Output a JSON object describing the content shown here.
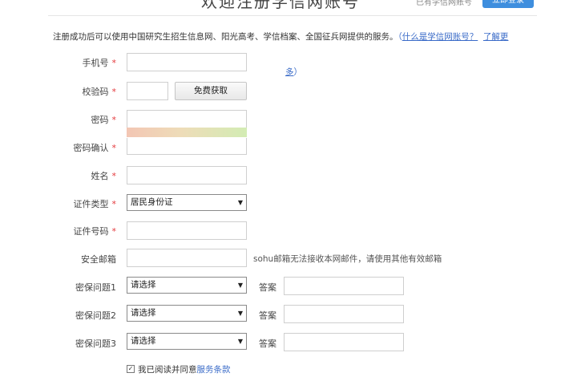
{
  "header": {
    "title": "欢迎注册学信网账号",
    "login_hint": "已有学信网账号",
    "login_button": "立即登录"
  },
  "notice": {
    "text": "注册成功后可以使用中国研究生招生信息网、阳光高考、学信档案、全国征兵网提供的服务。",
    "paren_open": "（",
    "link1": "什么是学信网账号？",
    "link2_part1": "了解更",
    "link2_part2": "多",
    "paren_close": "）"
  },
  "form": {
    "phone_label": "手机号",
    "code_label": "校验码",
    "code_button": "免费获取",
    "password_label": "密码",
    "password_confirm_label": "密码确认",
    "name_label": "姓名",
    "id_type_label": "证件类型",
    "id_type_value": "居民身份证",
    "id_number_label": "证件号码",
    "email_label": "安全邮箱",
    "email_hint": "sohu邮箱无法接收本网邮件，请使用其他有效邮箱",
    "q1_label": "密保问题1",
    "q2_label": "密保问题2",
    "q3_label": "密保问题3",
    "question_placeholder": "请选择",
    "answer_label": "答案",
    "required_mark": "*"
  },
  "agreement": {
    "checkmark": "✓",
    "text": "我已阅读并同意",
    "link": "服务条款"
  },
  "colors": {
    "accent": "#3e8ede",
    "link": "#3a6bc8",
    "required": "#e4393c"
  }
}
